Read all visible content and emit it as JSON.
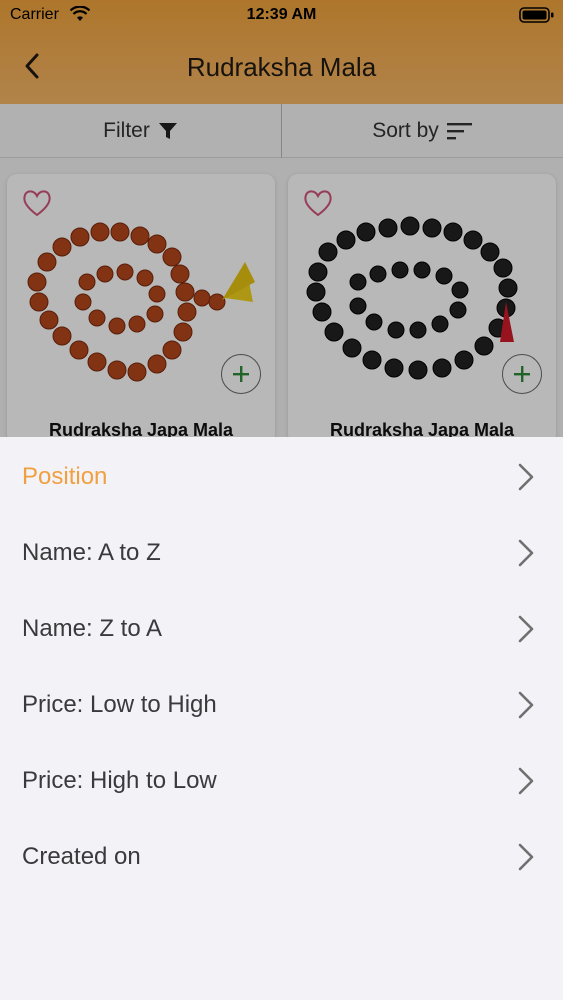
{
  "status_bar": {
    "carrier": "Carrier",
    "time": "12:39 AM"
  },
  "header": {
    "title": "Rudraksha Mala"
  },
  "toolbar": {
    "filter_label": "Filter",
    "sort_label": "Sort by"
  },
  "products": [
    {
      "name": "Rudraksha Japa Mala"
    },
    {
      "name": "Rudraksha Japa Mala"
    }
  ],
  "sort_options": [
    {
      "label": "Position",
      "active": true
    },
    {
      "label": "Name: A to Z"
    },
    {
      "label": "Name: Z to A"
    },
    {
      "label": "Price: Low to High"
    },
    {
      "label": "Price: High to Low"
    },
    {
      "label": "Created on"
    }
  ],
  "colors": {
    "accent": "#f0a040",
    "header": "#f2a43d"
  }
}
